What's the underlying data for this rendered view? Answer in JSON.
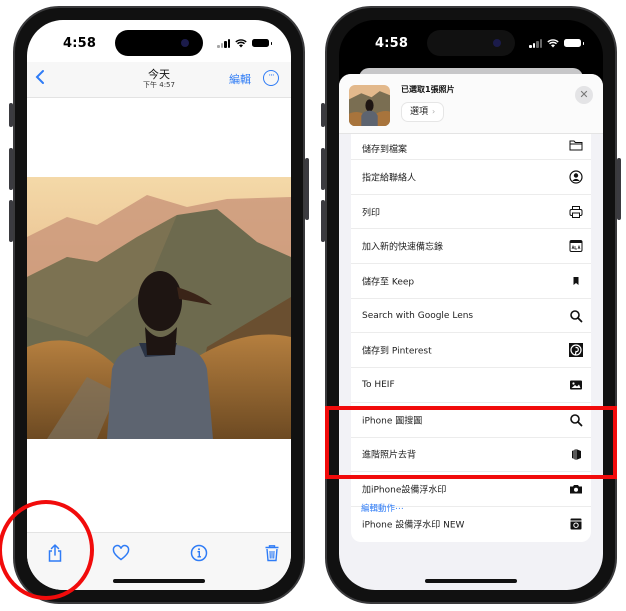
{
  "left_phone": {
    "status": {
      "time": "4:58"
    },
    "navbar": {
      "back_icon": "chevron-left-icon",
      "title": "今天",
      "subtitle": "下午 4:57",
      "edit_label": "編輯",
      "more_icon": "ellipsis-circle-icon"
    },
    "photo": {
      "description": "woman looking at mountains at sunset"
    },
    "toolbar": {
      "items": [
        {
          "name": "share",
          "icon": "share-icon"
        },
        {
          "name": "favorite",
          "icon": "heart-icon"
        },
        {
          "name": "info",
          "icon": "info-circle-icon"
        },
        {
          "name": "delete",
          "icon": "trash-icon"
        }
      ]
    },
    "highlight": {
      "color": "#f10b0b",
      "target": "share-button"
    }
  },
  "right_phone": {
    "status": {
      "time": "4:58"
    },
    "sheet": {
      "title": "已選取1張照片",
      "options_label": "選項",
      "options_chevron": "›",
      "close_icon": "✕",
      "actions": [
        {
          "label": "儲存到檔案",
          "icon": "folder-icon"
        },
        {
          "label": "指定給聯絡人",
          "icon": "person-circle-icon"
        },
        {
          "label": "列印",
          "icon": "printer-icon"
        },
        {
          "label": "加入新的快速備忘錄",
          "icon": "quick-note-icon"
        },
        {
          "label": "儲存至 Keep",
          "icon": "bookmark-icon"
        },
        {
          "label": "Search with Google Lens",
          "icon": "search-icon"
        },
        {
          "label": "儲存到 Pinterest",
          "icon": "pinterest-icon"
        },
        {
          "label": "To HEIF",
          "icon": "photo-icon"
        },
        {
          "label": "iPhone 圖搜圖",
          "icon": "search-icon"
        },
        {
          "label": "進階照片去背",
          "icon": "layers-icon"
        },
        {
          "label": "加iPhone設備浮水印",
          "icon": "camera-icon"
        },
        {
          "label": "iPhone 設備浮水印 NEW",
          "icon": "camera-frame-icon"
        }
      ],
      "edit_actions_label": "編輯動作⋯"
    },
    "highlight": {
      "color": "#f10b0b",
      "target": "進階照片去背"
    }
  },
  "colors": {
    "accent": "#2f7cf6",
    "highlight": "#f10b0b"
  }
}
